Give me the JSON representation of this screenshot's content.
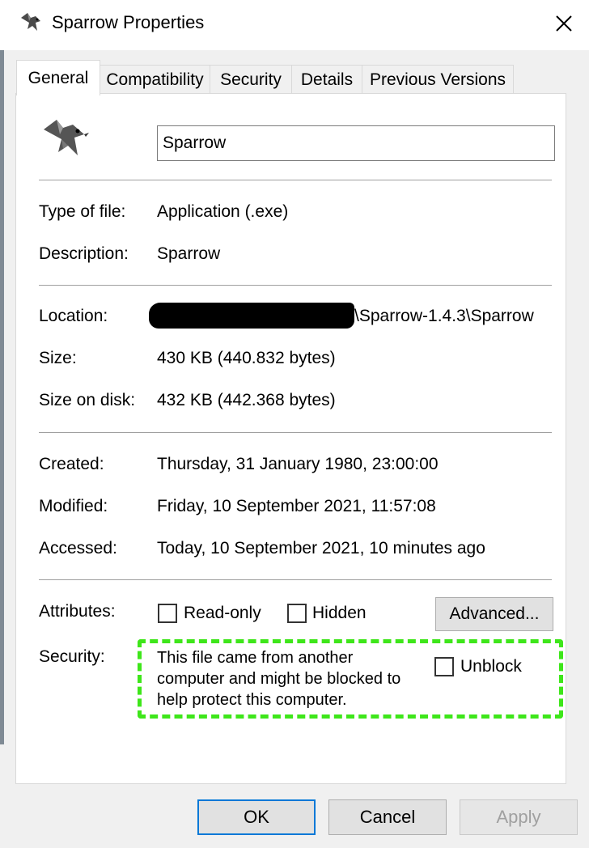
{
  "window": {
    "title": "Sparrow Properties",
    "app_icon": "sparrow-bird-icon",
    "close_icon": "close-icon"
  },
  "tabs": [
    {
      "label": "General",
      "active": true
    },
    {
      "label": "Compatibility",
      "active": false
    },
    {
      "label": "Security",
      "active": false
    },
    {
      "label": "Details",
      "active": false
    },
    {
      "label": "Previous Versions",
      "active": false
    }
  ],
  "general": {
    "file_name": "Sparrow",
    "type_of_file": {
      "label": "Type of file:",
      "value": "Application (.exe)"
    },
    "description": {
      "label": "Description:",
      "value": "Sparrow"
    },
    "location": {
      "label": "Location:",
      "value": "\\Sparrow-1.4.3\\Sparrow",
      "redacted_prefix": true
    },
    "size": {
      "label": "Size:",
      "value": "430 KB (440.832 bytes)"
    },
    "size_on_disk": {
      "label": "Size on disk:",
      "value": "432 KB (442.368 bytes)"
    },
    "created": {
      "label": "Created:",
      "value": "Thursday, 31 January 1980, 23:00:00"
    },
    "modified": {
      "label": "Modified:",
      "value": "Friday, 10 September 2021, 11:57:08"
    },
    "accessed": {
      "label": "Accessed:",
      "value": "Today, 10 September 2021, 10 minutes ago"
    },
    "attributes": {
      "label": "Attributes:",
      "read_only": {
        "label": "Read-only",
        "checked": false
      },
      "hidden": {
        "label": "Hidden",
        "checked": false
      },
      "advanced_label": "Advanced..."
    },
    "security": {
      "label": "Security:",
      "line1": "This file came from another",
      "line2": "computer and might be blocked to",
      "line3": "help protect this computer.",
      "unblock": {
        "label": "Unblock",
        "checked": false
      },
      "highlight_color": "#3ee61a"
    }
  },
  "buttons": {
    "ok": "OK",
    "cancel": "Cancel",
    "apply": "Apply",
    "apply_enabled": false
  },
  "colors": {
    "accent": "#0078d7",
    "panel_bg": "#ffffff",
    "dialog_bg": "#f0f0f0"
  }
}
